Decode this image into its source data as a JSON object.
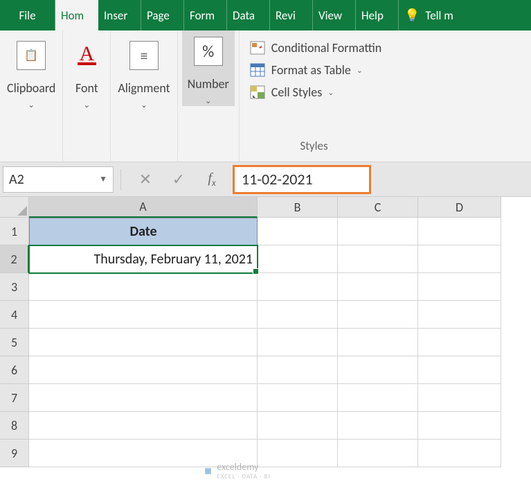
{
  "tabs": {
    "file": "File",
    "home": "Hom",
    "insert": "Inser",
    "page": "Page",
    "form": "Form",
    "data": "Data",
    "review": "Revi",
    "view": "View",
    "help": "Help",
    "tell": "Tell m"
  },
  "ribbon": {
    "clipboard": "Clipboard",
    "font": "Font",
    "alignment": "Alignment",
    "number": "Number",
    "percent": "%",
    "cond_format": "Conditional Formattin",
    "format_table": "Format as Table",
    "cell_styles": "Cell Styles",
    "styles": "Styles"
  },
  "formula_bar": {
    "name_box": "A2",
    "value": "11-02-2021"
  },
  "columns": [
    "A",
    "B",
    "C",
    "D"
  ],
  "rows": [
    "1",
    "2",
    "3",
    "4",
    "5",
    "6",
    "7",
    "8",
    "9"
  ],
  "cells": {
    "a1": "Date",
    "a2": "Thursday, February 11, 2021"
  },
  "watermark": {
    "name": "exceldemy",
    "tagline": "EXCEL · DATA · BI"
  }
}
